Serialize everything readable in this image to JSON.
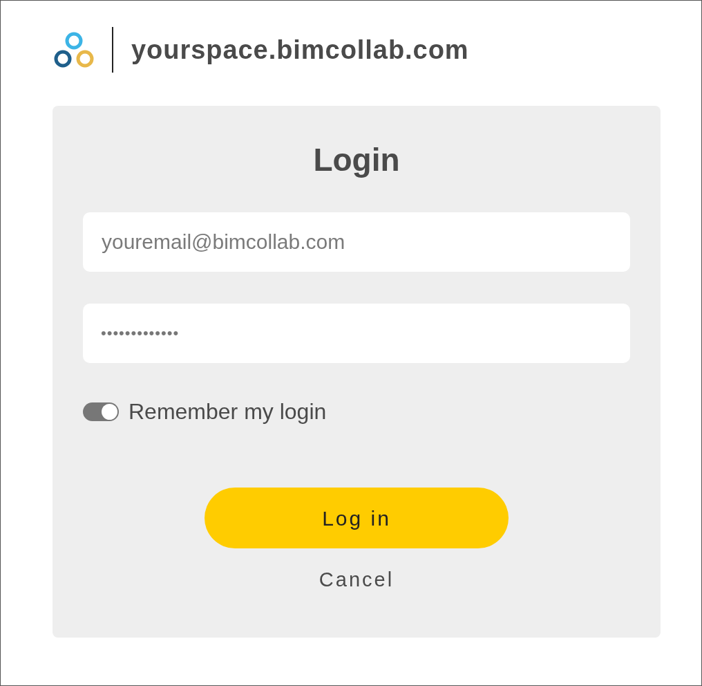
{
  "header": {
    "site": "yourspace.bimcollab.com"
  },
  "login": {
    "title": "Login",
    "email": {
      "placeholder": "youremail@bimcollab.com"
    },
    "password": {
      "value": "•••••••••••••"
    },
    "remember": {
      "label": "Remember my login",
      "on": true
    },
    "submit": "Log in",
    "cancel": "Cancel"
  }
}
